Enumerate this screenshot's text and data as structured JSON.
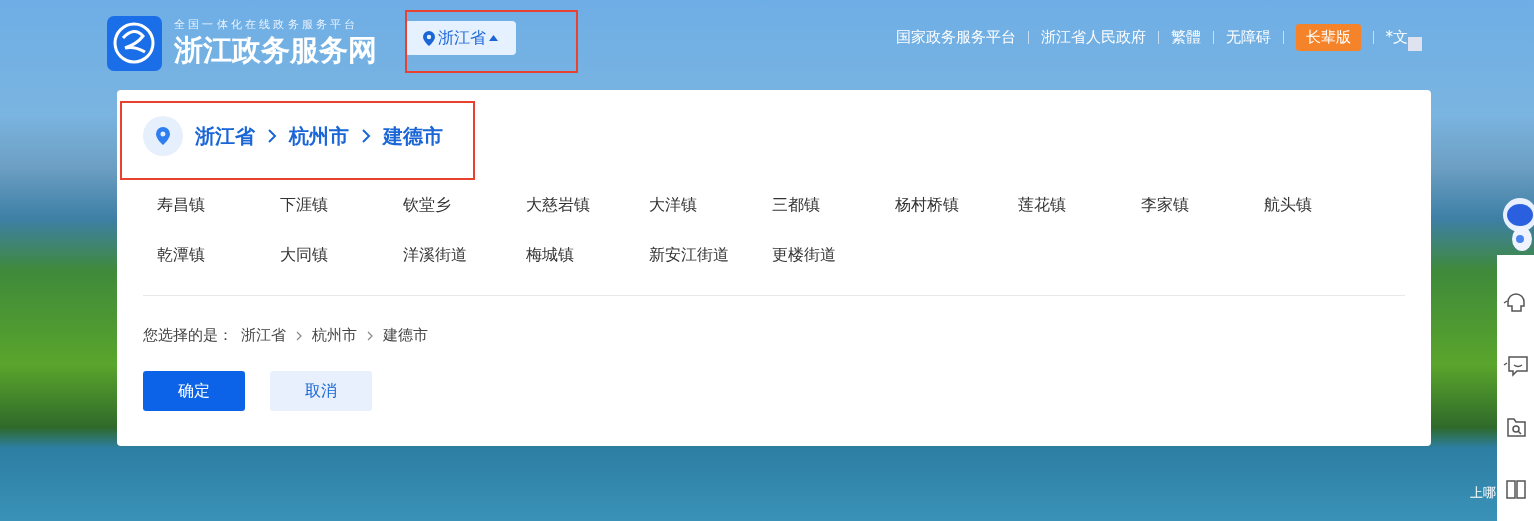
{
  "header": {
    "subtitle": "全国一体化在线政务服务平台",
    "title": "浙江政务服务网",
    "location_button": {
      "label": "浙江省",
      "expanded": true
    },
    "links": [
      {
        "label": "国家政务服务平台",
        "kind": "link"
      },
      {
        "label": "浙江省人民政府",
        "kind": "link"
      },
      {
        "label": "繁體",
        "kind": "link"
      },
      {
        "label": "无障碍",
        "kind": "link"
      },
      {
        "label": "长辈版",
        "kind": "badge"
      },
      {
        "label": "*文",
        "kind": "link"
      }
    ]
  },
  "region_dialog": {
    "path": [
      "浙江省",
      "杭州市",
      "建德市"
    ],
    "towns": [
      {
        "label": "寿昌镇"
      },
      {
        "label": "下涯镇"
      },
      {
        "label": "钦堂乡"
      },
      {
        "label": "大慈岩镇"
      },
      {
        "label": "大洋镇"
      },
      {
        "label": "三都镇"
      },
      {
        "label": "杨村桥镇"
      },
      {
        "label": "莲花镇"
      },
      {
        "label": "李家镇"
      },
      {
        "label": "航头镇"
      },
      {
        "label": "乾潭镇"
      },
      {
        "label": "大同镇"
      },
      {
        "label": "洋溪街道"
      },
      {
        "label": "梅城镇"
      },
      {
        "label": "新安江街道"
      },
      {
        "label": "更楼街道"
      }
    ],
    "selection_label": "您选择的是：",
    "selection_path": [
      "浙江省",
      "杭州市",
      "建德市"
    ],
    "buttons": [
      {
        "label": "确定",
        "kind": "primary"
      },
      {
        "label": "取消",
        "kind": "secondary"
      }
    ]
  },
  "corner_text": "上哪"
}
